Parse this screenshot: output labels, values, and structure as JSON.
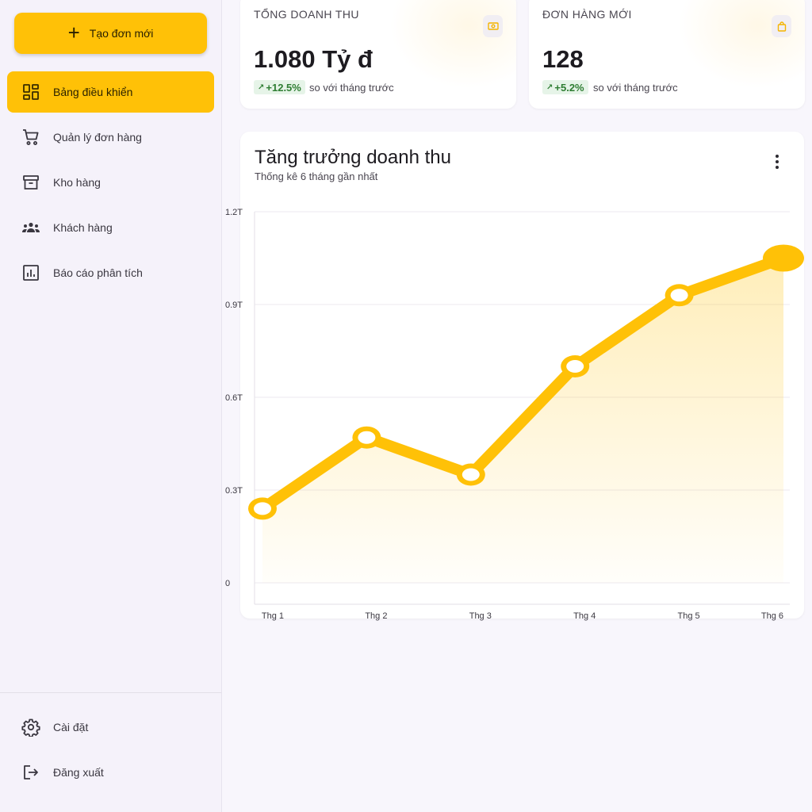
{
  "sidebar": {
    "new_order_label": "Tạo đơn mới",
    "items": [
      {
        "label": "Bảng điều khiển",
        "icon": "dashboard-icon",
        "active": true
      },
      {
        "label": "Quản lý đơn hàng",
        "icon": "cart-icon"
      },
      {
        "label": "Kho hàng",
        "icon": "archive-icon"
      },
      {
        "label": "Khách hàng",
        "icon": "group-icon"
      },
      {
        "label": "Báo cáo phân tích",
        "icon": "analytics-icon"
      }
    ],
    "footer": [
      {
        "label": "Cài đặt",
        "icon": "gear-icon"
      },
      {
        "label": "Đăng xuất",
        "icon": "logout-icon"
      }
    ]
  },
  "stats": [
    {
      "label": "TỔNG DOANH THU",
      "value": "1.080 Tỷ đ",
      "change": "+12.5%",
      "note": "so với tháng trước",
      "icon": "cash-icon"
    },
    {
      "label": "ĐƠN HÀNG MỚI",
      "value": "128",
      "change": "+5.2%",
      "note": "so với tháng trước",
      "icon": "shopping-bag-icon"
    }
  ],
  "chart": {
    "title": "Tăng trưởng doanh thu",
    "subtitle": "Thống kê 6 tháng gần nhất"
  },
  "colors": {
    "accent": "#ffc107",
    "trend_positive": "#2e7d32"
  },
  "chart_data": {
    "type": "area",
    "categories": [
      "Thg 1",
      "Thg 2",
      "Thg 3",
      "Thg 4",
      "Thg 5",
      "Thg 6"
    ],
    "values": [
      0.24,
      0.47,
      0.35,
      0.7,
      0.93,
      1.05
    ],
    "yticks": [
      0,
      0.3,
      0.6,
      0.9,
      1.2
    ],
    "ytick_labels": [
      "0",
      "0.3T",
      "0.6T",
      "0.9T",
      "1.2T"
    ],
    "ylim": [
      0,
      1.2
    ],
    "grid": true,
    "title": "Tăng trưởng doanh thu",
    "xlabel": "",
    "ylabel": ""
  }
}
